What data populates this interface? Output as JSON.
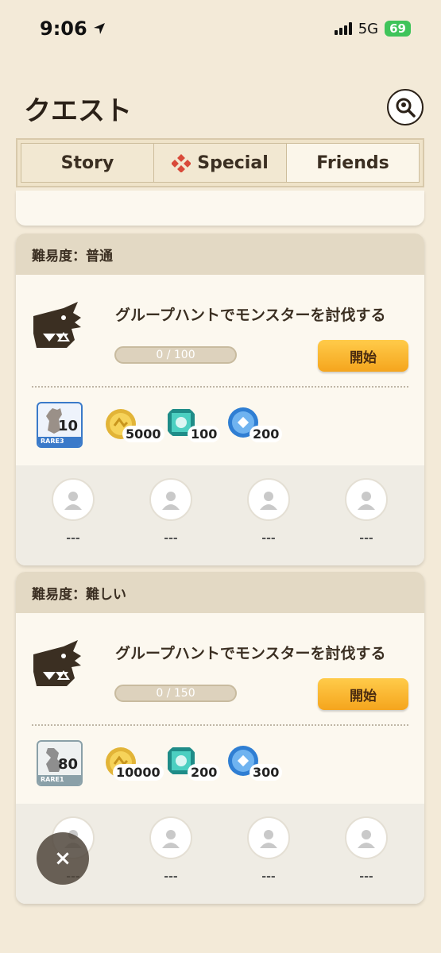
{
  "status_bar": {
    "time": "9:06",
    "network": "5G",
    "battery": "69"
  },
  "page": {
    "title": "クエスト"
  },
  "tabs": [
    {
      "label": "Story"
    },
    {
      "label": "Special"
    },
    {
      "label": "Friends"
    }
  ],
  "quests": [
    {
      "difficulty": "難易度：普通",
      "title": "グループハントでモンスターを討伐する",
      "progress": "0 / 100",
      "start_label": "開始",
      "reward_badge": {
        "level": "10",
        "rarity": "RARE3"
      },
      "rewards": [
        {
          "amount": "5000"
        },
        {
          "amount": "100"
        },
        {
          "amount": "200"
        }
      ],
      "participants": [
        "---",
        "---",
        "---",
        "---"
      ]
    },
    {
      "difficulty": "難易度：難しい",
      "title": "グループハントでモンスターを討伐する",
      "progress": "0 / 150",
      "start_label": "開始",
      "reward_badge": {
        "level": "80",
        "rarity": "RARE1"
      },
      "rewards": [
        {
          "amount": "10000"
        },
        {
          "amount": "200"
        },
        {
          "amount": "300"
        }
      ],
      "participants": [
        "---",
        "---",
        "---",
        "---"
      ]
    }
  ],
  "close_label": "×",
  "colors": {
    "accent": "#f5a51d",
    "header_bg": "#e3d9c4",
    "rare3": "#3a7ac9",
    "rare1": "#8aa0a8"
  }
}
